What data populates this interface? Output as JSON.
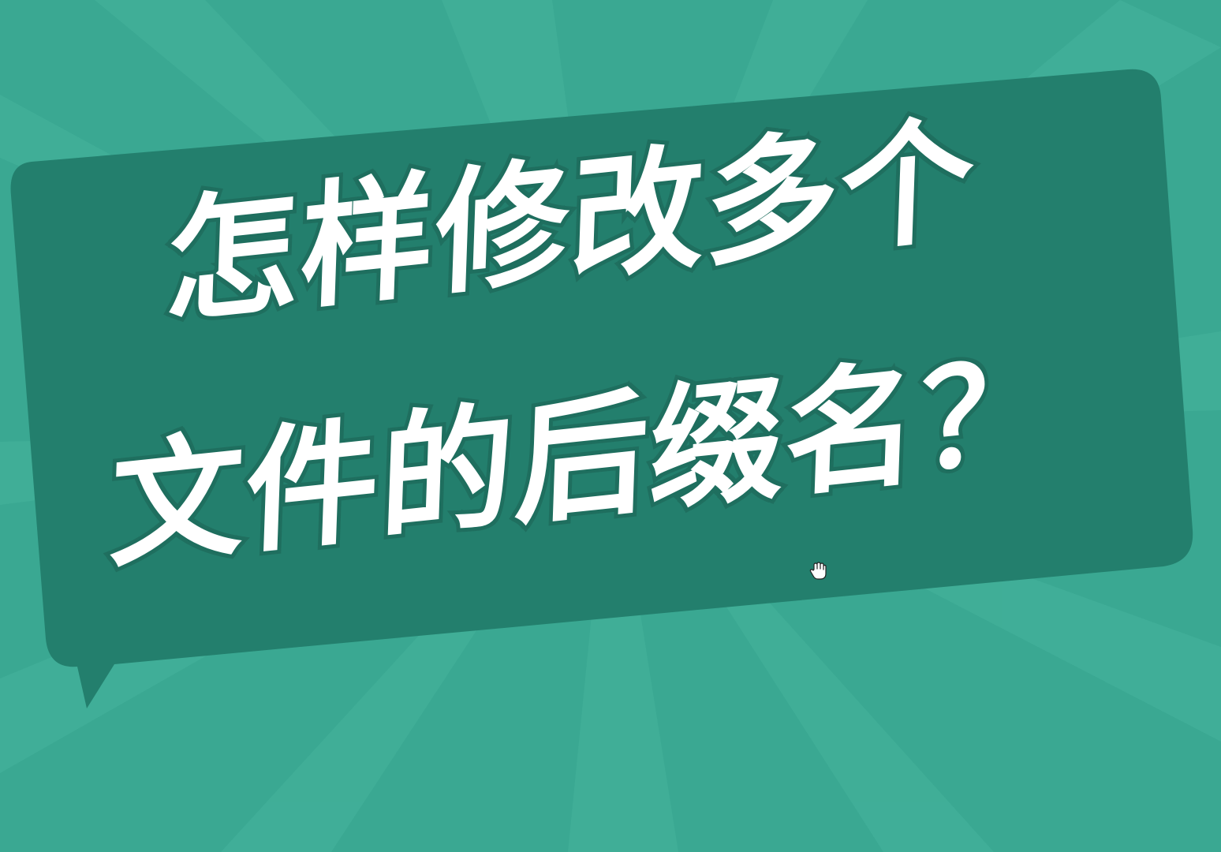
{
  "title": {
    "line1": "怎样修改多个",
    "line2": "文件的后缀名？"
  },
  "colors": {
    "background": "#3aa892",
    "ray": "#45b39c",
    "bubble": "#237f6d",
    "text": "#ffffff",
    "outline": "#1f6f5f"
  },
  "icons": {
    "cursor": "hand-cursor-icon"
  }
}
